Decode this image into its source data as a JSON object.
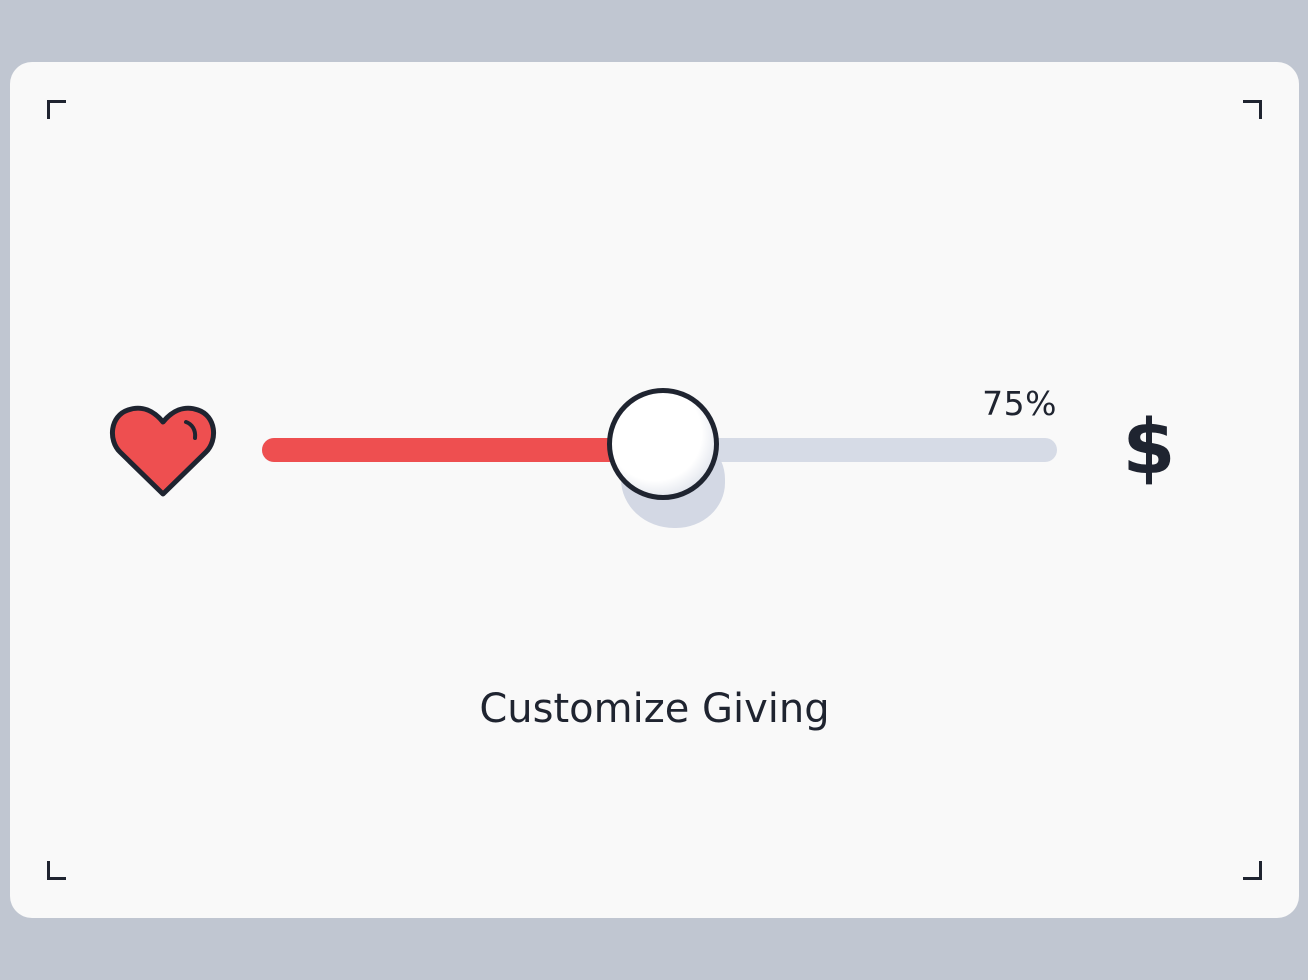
{
  "slider": {
    "percent_label": "75%",
    "value_fraction": 0.75
  },
  "title": "Customize Giving",
  "icons": {
    "left": "heart-icon",
    "right": "dollar-icon",
    "dollar_glyph": "$"
  },
  "colors": {
    "background": "#c0c6d1",
    "card": "#f9f9f9",
    "accent": "#ee4f50",
    "track": "#d6dbe6",
    "ink": "#1f2430"
  }
}
